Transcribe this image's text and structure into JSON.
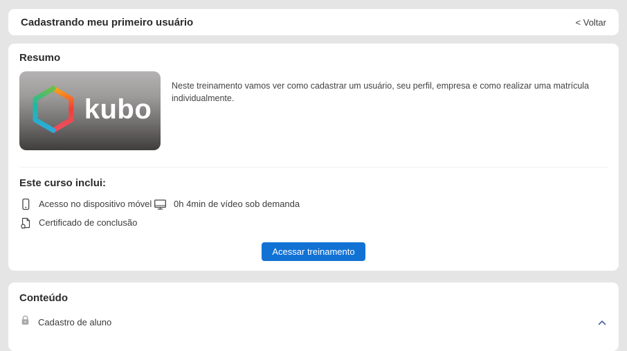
{
  "page": {
    "background_color": "#e5e5e5",
    "card_color": "#ffffff",
    "accent_blue": "#1272d4",
    "chevron_color": "#4a6398"
  },
  "header": {
    "title": "Cadastrando meu primeiro usuário",
    "back_label": "< Voltar"
  },
  "summary": {
    "title": "Resumo",
    "description": "Neste treinamento vamos ver como cadastrar um usuário, seu perfil, empresa e como realizar uma matrícula individualmente.",
    "thumbnail": {
      "logo_text": "kubo",
      "logo_icon": "kubo-hexagon-icon",
      "logo_gradient_right": [
        "#f9a61a",
        "#ef4136",
        "#ec4f63"
      ],
      "logo_gradient_left": [
        "#6abf4b",
        "#1db8a5",
        "#2da9e0"
      ]
    }
  },
  "includes": {
    "title": "Este curso inclui:",
    "items": [
      {
        "icon": "mobile-icon",
        "label": "Acesso no dispositivo móvel"
      },
      {
        "icon": "monitor-icon",
        "label": "0h 4min de vídeo sob demanda"
      },
      {
        "icon": "certificate-icon",
        "label": "Certificado de conclusão"
      }
    ],
    "cta_label": "Acessar treinamento"
  },
  "content": {
    "title": "Conteúdo",
    "sections": [
      {
        "icon": "lock-icon",
        "label": "Cadastro de aluno",
        "expanded": true
      }
    ]
  }
}
